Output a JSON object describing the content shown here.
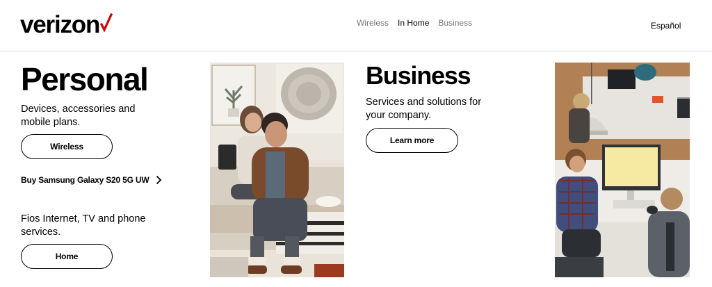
{
  "brand": {
    "name": "verizon",
    "accent": "#cd040b"
  },
  "nav": {
    "items": [
      "Wireless",
      "In Home",
      "Business"
    ],
    "active_index": 1
  },
  "language_link": "Español",
  "personal": {
    "title": "Personal",
    "wireless_desc": "Devices, accessories and mobile plans.",
    "wireless_button": "Wireless",
    "promo_link": "Buy Samsung Galaxy S20 5G UW",
    "home_desc": "Fios Internet, TV and phone services.",
    "home_button": "Home"
  },
  "business": {
    "title": "Business",
    "desc": "Services and solutions for your company.",
    "button": "Learn more"
  }
}
